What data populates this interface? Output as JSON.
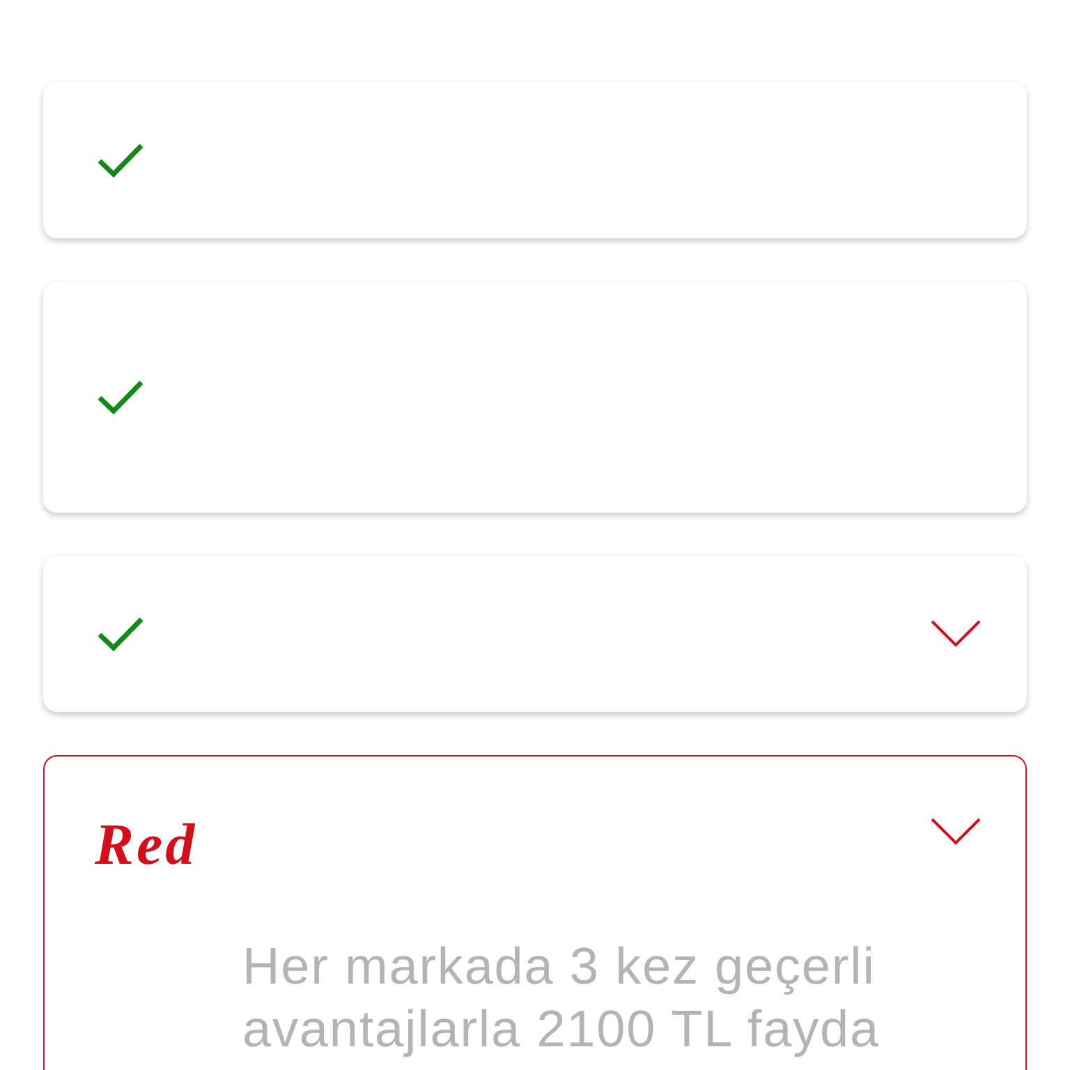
{
  "offers": [
    {
      "kind": "check",
      "selected": false,
      "expandable": false
    },
    {
      "kind": "check",
      "selected": false,
      "expandable": false
    },
    {
      "kind": "check",
      "selected": false,
      "expandable": true
    },
    {
      "kind": "logo",
      "logo": "Red",
      "selected": true,
      "expandable": true,
      "description": "Her markada 3 kez geçerli avantajlarla 2100 TL fayda"
    }
  ]
}
